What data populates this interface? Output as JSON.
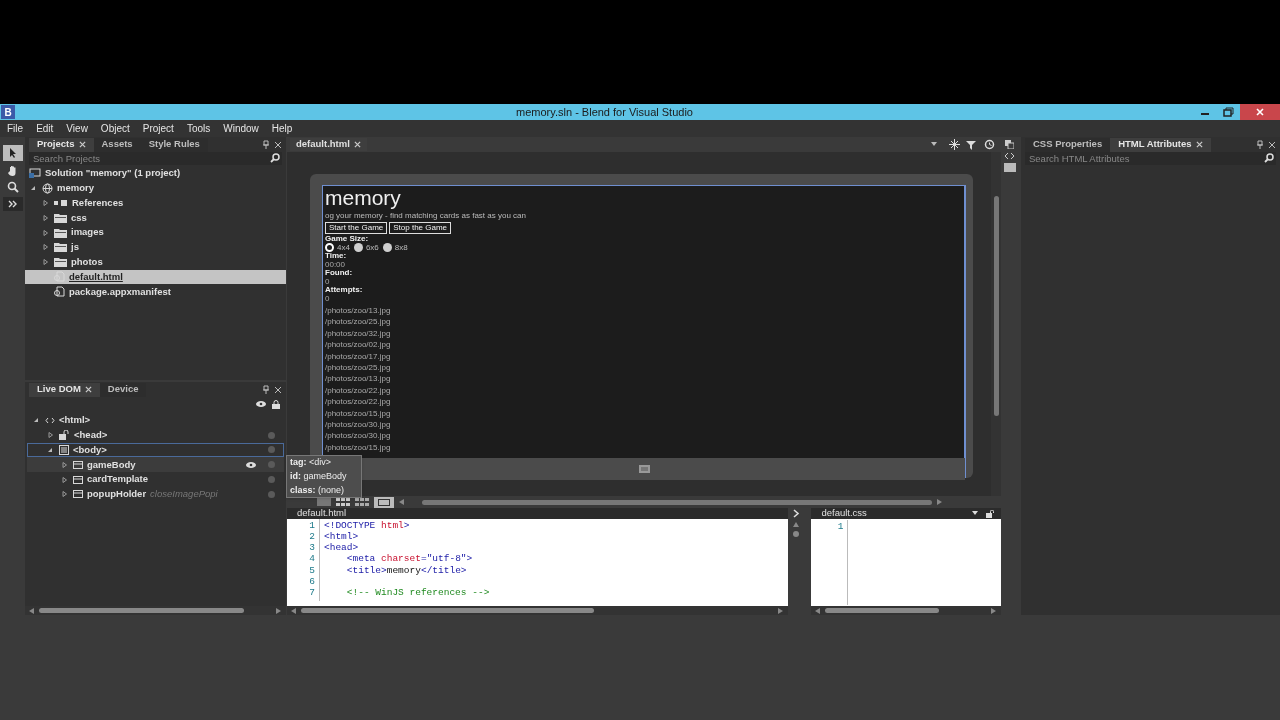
{
  "window": {
    "title": "memory.sln - Blend for Visual Studio",
    "app_mark": "B"
  },
  "menu": [
    "File",
    "Edit",
    "View",
    "Object",
    "Project",
    "Tools",
    "Window",
    "Help"
  ],
  "projects_panel": {
    "tabs": [
      {
        "label": "Projects",
        "selected": true,
        "closable": true
      },
      {
        "label": "Assets",
        "selected": false,
        "closable": false
      },
      {
        "label": "Style Rules",
        "selected": false,
        "closable": false
      }
    ],
    "search": {
      "placeholder": "Search Projects"
    },
    "tree": [
      {
        "label": "Solution \"memory\" (1 project)",
        "kind": "solution",
        "selected": false,
        "children": [
          {
            "label": "memory",
            "kind": "project",
            "expanded": true,
            "selected": false,
            "children": [
              {
                "label": "References",
                "kind": "references",
                "expanded": false,
                "selected": false
              },
              {
                "label": "css",
                "kind": "folder",
                "expanded": false,
                "selected": false
              },
              {
                "label": "images",
                "kind": "folder",
                "expanded": false,
                "selected": false
              },
              {
                "label": "js",
                "kind": "folder",
                "expanded": false,
                "selected": false
              },
              {
                "label": "photos",
                "kind": "folder",
                "expanded": false,
                "selected": false
              },
              {
                "label": "default.html",
                "kind": "file",
                "selected": true
              },
              {
                "label": "package.appxmanifest",
                "kind": "file",
                "selected": false
              }
            ]
          }
        ]
      }
    ]
  },
  "dom_panel": {
    "tabs": [
      {
        "label": "Live DOM",
        "selected": true,
        "closable": true
      },
      {
        "label": "Device",
        "selected": false,
        "closable": false
      }
    ],
    "tree": [
      {
        "label": "<html>",
        "kind": "html",
        "expanded": true,
        "selected": false,
        "hovered": false,
        "children": [
          {
            "label": "<head>",
            "kind": "head",
            "expanded": false,
            "selected": false,
            "hovered": false
          },
          {
            "label": "<body>",
            "kind": "body",
            "expanded": true,
            "selected": true,
            "hovered": false,
            "children": [
              {
                "label": "gameBody",
                "kind": "element",
                "expanded": false,
                "selected": false,
                "hovered": true
              },
              {
                "label": "cardTemplate",
                "kind": "element",
                "expanded": false,
                "selected": false,
                "hovered": false
              },
              {
                "label": "popupHolder",
                "note": "closeImagePopi",
                "kind": "element",
                "expanded": false,
                "selected": false,
                "hovered": false
              }
            ]
          }
        ]
      }
    ]
  },
  "tooltip": [
    {
      "key": "tag:",
      "value": "<div>"
    },
    {
      "key": "id:",
      "value": "gameBody"
    },
    {
      "key": "class:",
      "value": "(none)"
    }
  ],
  "document_tab": {
    "label": "default.html"
  },
  "app_preview": {
    "heading": "memory",
    "subtitle": "og your memory - find matching cards as fast as you can",
    "buttons": [
      "Start the Game",
      "Stop the Game"
    ],
    "game_size_label": "Game Size:",
    "sizes": [
      {
        "label": "4x4",
        "selected": true
      },
      {
        "label": "6x6",
        "selected": false
      },
      {
        "label": "8x8",
        "selected": false
      }
    ],
    "stats": [
      {
        "label": "Time:",
        "value": "00:00"
      },
      {
        "label": "Found:",
        "value": "0"
      },
      {
        "label": "Attempts:",
        "value": "0"
      }
    ],
    "photos": [
      "/photos/zoo/13.jpg",
      "/photos/zoo/25.jpg",
      "/photos/zoo/32.jpg",
      "/photos/zoo/02.jpg",
      "/photos/zoo/17.jpg",
      "/photos/zoo/25.jpg",
      "/photos/zoo/13.jpg",
      "/photos/zoo/22.jpg",
      "/photos/zoo/22.jpg",
      "/photos/zoo/15.jpg",
      "/photos/zoo/30.jpg",
      "/photos/zoo/30.jpg",
      "/photos/zoo/15.jpg"
    ]
  },
  "html_editor": {
    "title": "default.html",
    "lines": [
      {
        "number": "1",
        "tokens": [
          {
            "kind": "tag",
            "text": "<!DOCTYPE "
          },
          {
            "kind": "attr",
            "text": "html"
          },
          {
            "kind": "tag",
            "text": ">"
          }
        ]
      },
      {
        "number": "2",
        "tokens": [
          {
            "kind": "tag",
            "text": "<html>"
          }
        ]
      },
      {
        "number": "3",
        "tokens": [
          {
            "kind": "tag",
            "text": "<head>"
          }
        ]
      },
      {
        "number": "4",
        "tokens": [
          {
            "kind": "tag",
            "text": "    <meta "
          },
          {
            "kind": "attr",
            "text": "charset"
          },
          {
            "kind": "tag",
            "text": "="
          },
          {
            "kind": "value",
            "text": "\"utf-8\""
          },
          {
            "kind": "tag",
            "text": ">"
          }
        ]
      },
      {
        "number": "5",
        "tokens": [
          {
            "kind": "tag",
            "text": "    <title>"
          },
          {
            "kind": "text",
            "text": "memory"
          },
          {
            "kind": "tag",
            "text": "</title>"
          }
        ]
      },
      {
        "number": "6"
      },
      {
        "number": "7",
        "tokens": [
          {
            "kind": "comment",
            "text": "    <!-- WinJS references -->"
          }
        ]
      }
    ]
  },
  "css_editor": {
    "title": "default.css",
    "lines": [
      {
        "number": "1"
      }
    ]
  },
  "properties_panel": {
    "tabs": [
      {
        "label": "CSS Properties",
        "selected": false,
        "closable": false
      },
      {
        "label": "HTML Attributes",
        "selected": true,
        "closable": true
      }
    ],
    "search": {
      "placeholder": "Search HTML Attributes"
    }
  }
}
